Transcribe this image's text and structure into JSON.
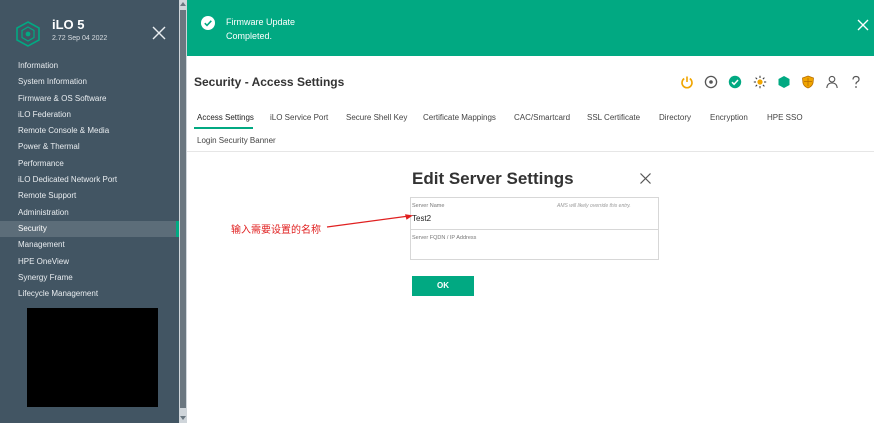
{
  "brand": {
    "title": "iLO 5",
    "version": "2.72 Sep 04 2022"
  },
  "sidebar": {
    "items": [
      {
        "label": "Information"
      },
      {
        "label": "System Information"
      },
      {
        "label": "Firmware & OS Software"
      },
      {
        "label": "iLO Federation"
      },
      {
        "label": "Remote Console & Media"
      },
      {
        "label": "Power & Thermal"
      },
      {
        "label": "Performance"
      },
      {
        "label": "iLO Dedicated Network Port"
      },
      {
        "label": "Remote Support"
      },
      {
        "label": "Administration"
      },
      {
        "label": "Security",
        "active": true
      },
      {
        "label": "Management"
      },
      {
        "label": "HPE OneView"
      },
      {
        "label": "Synergy Frame"
      },
      {
        "label": "Lifecycle Management"
      }
    ]
  },
  "banner": {
    "title": "Firmware Update",
    "subtitle": "Completed."
  },
  "header": {
    "title": "Security - Access Settings",
    "icons": [
      "power-icon",
      "uid-icon",
      "health-ok-icon",
      "sun-icon",
      "hexagon-icon",
      "shield-icon",
      "user-icon",
      "help-icon"
    ]
  },
  "tabs": [
    {
      "label": "Access Settings",
      "active": true
    },
    {
      "label": "iLO Service Port"
    },
    {
      "label": "Secure Shell Key"
    },
    {
      "label": "Certificate Mappings"
    },
    {
      "label": "CAC/Smartcard"
    },
    {
      "label": "SSL Certificate"
    },
    {
      "label": "Directory"
    },
    {
      "label": "Encryption"
    },
    {
      "label": "HPE SSO"
    },
    {
      "label": "Login Security Banner"
    }
  ],
  "dialog": {
    "title": "Edit Server Settings",
    "server_name_label": "Server Name",
    "server_name_hint": "AMS will likely override this entry.",
    "server_name_value": "Test2",
    "fqdn_label": "Server FQDN / IP Address",
    "fqdn_value": "",
    "ok_label": "OK"
  },
  "annotation": {
    "text": "输入需要设置的名称"
  },
  "colors": {
    "sidebar_bg": "#425563",
    "accent": "#01a982",
    "annotation": "#e02020",
    "power_icon": "#f0a500",
    "sun_icon": "#f0a500",
    "shield_icon": "#d88a00"
  }
}
